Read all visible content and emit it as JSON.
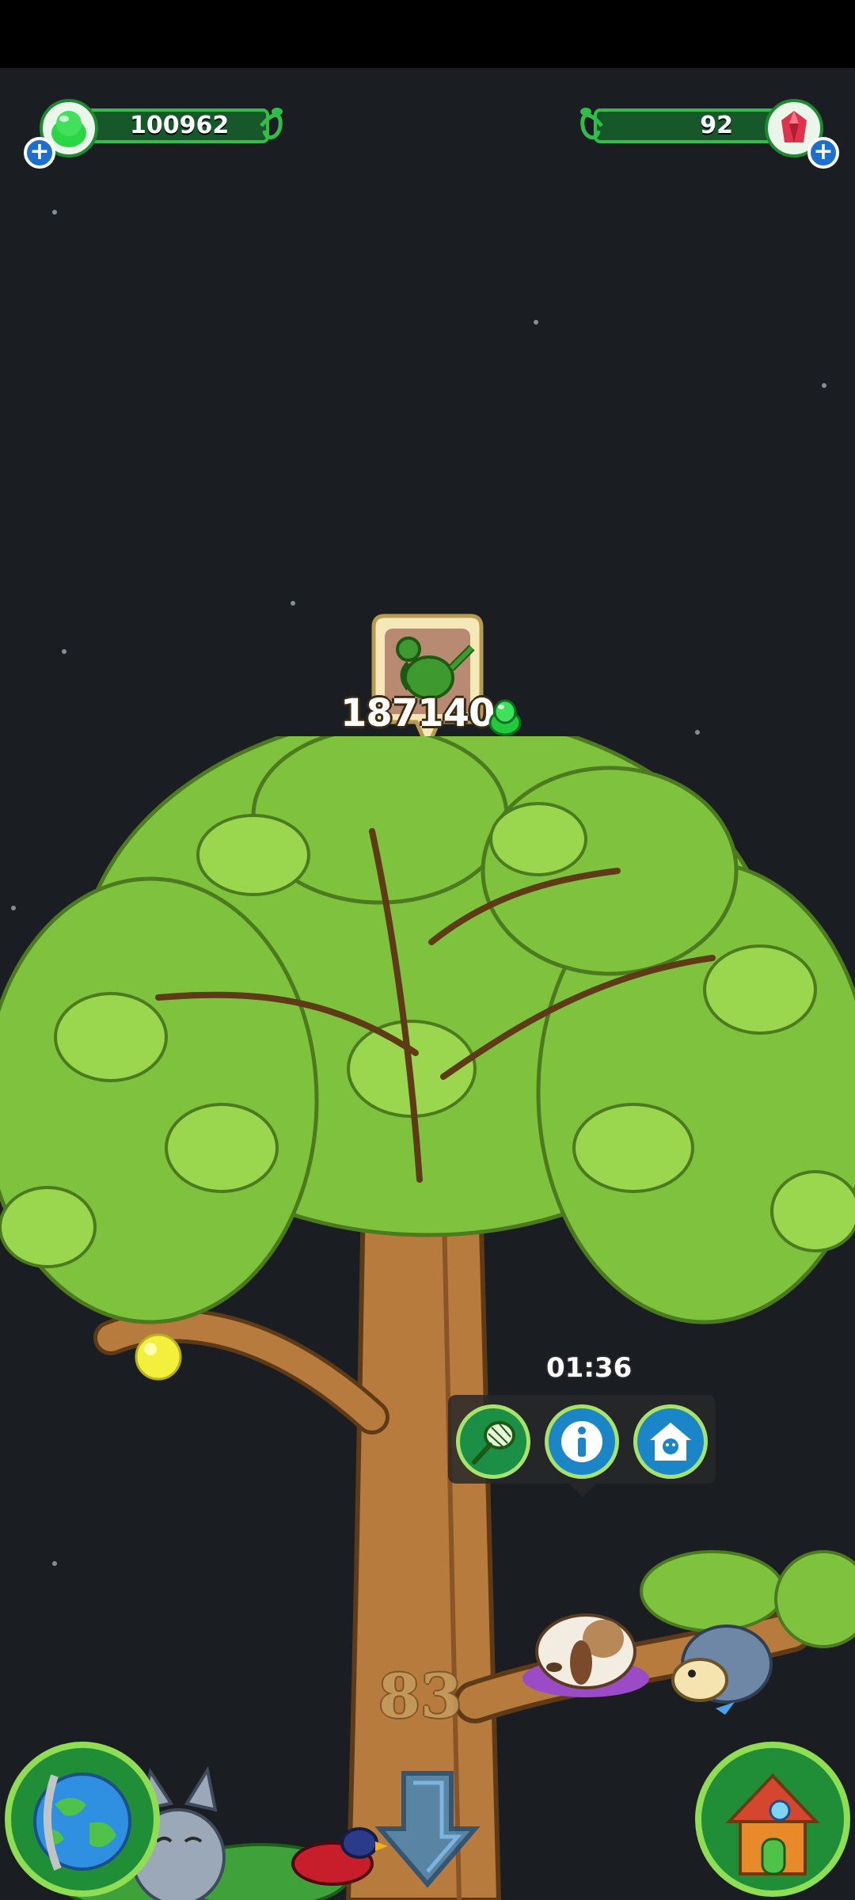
{
  "currency": {
    "jelly": {
      "value": "100962",
      "icon": "green-jelly-icon",
      "add_icon": "plus-icon"
    },
    "gems": {
      "value": "92",
      "icon": "red-gem-icon",
      "add_icon": "plus-icon"
    }
  },
  "upgrade": {
    "icon": "watering-can-icon",
    "cost": "187140",
    "cost_icon": "green-jelly-icon"
  },
  "tree": {
    "level": "83",
    "timer": "01:36"
  },
  "actions": [
    {
      "name": "net",
      "icon": "butterfly-net-icon"
    },
    {
      "name": "info",
      "icon": "info-icon"
    },
    {
      "name": "shelter",
      "icon": "animal-house-icon"
    }
  ],
  "nav": {
    "world": "globe-icon",
    "scroll_down": "down-arrow-icon",
    "home": "house-icon"
  },
  "colors": {
    "background": "#1a1e22",
    "leaf": "#7fc23d",
    "trunk": "#b77b3e",
    "ui_green": "#2fbf48"
  }
}
